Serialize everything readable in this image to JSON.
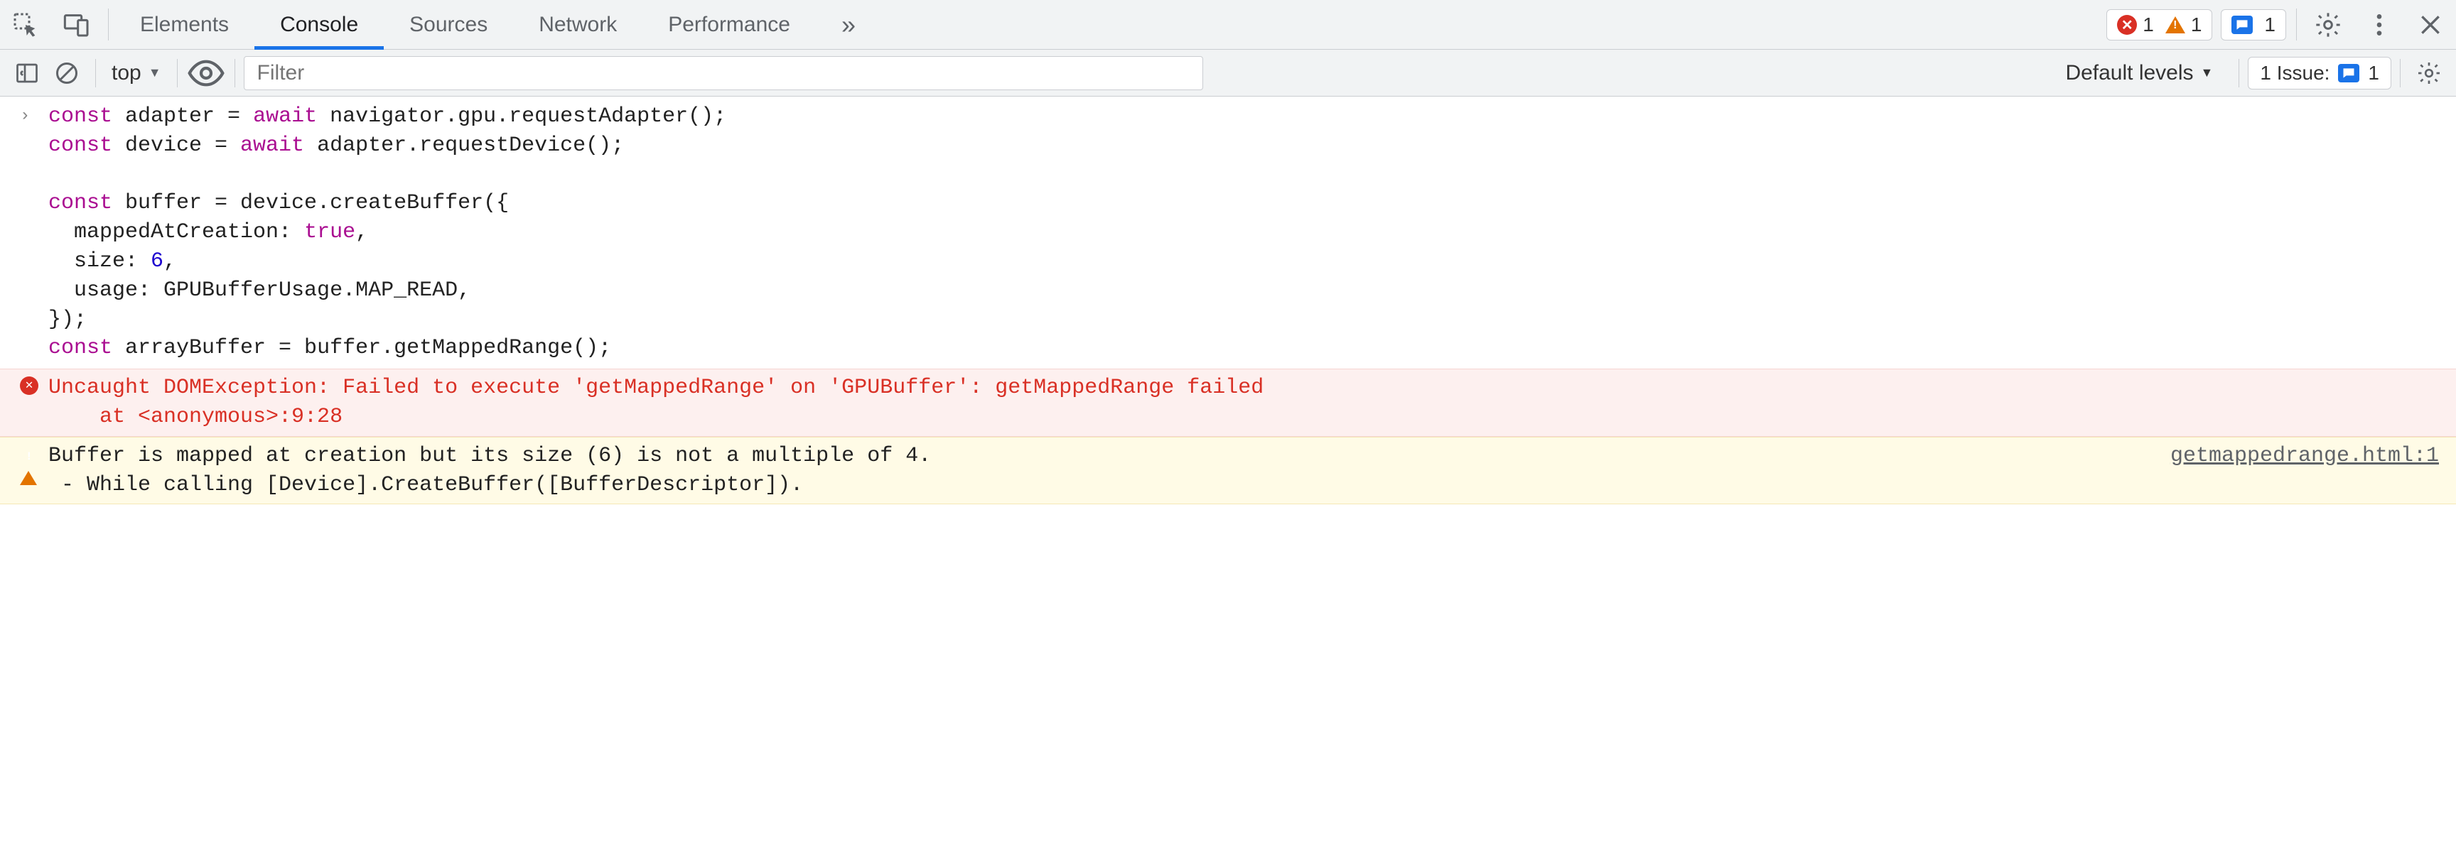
{
  "tabs": {
    "elements": "Elements",
    "console": "Console",
    "sources": "Sources",
    "network": "Network",
    "performance": "Performance"
  },
  "badges": {
    "errors": "1",
    "warnings": "1",
    "info": "1"
  },
  "toolbar": {
    "context": "top",
    "filter_placeholder": "Filter",
    "levels": "Default levels",
    "issues_label": "1 Issue:",
    "issues_count": "1"
  },
  "console_input": {
    "prompt": "›",
    "tokens": {
      "const": "const",
      "await": "await",
      "true": "true",
      "six": "6",
      "line1a": " adapter = ",
      "line1b": " navigator.gpu.requestAdapter();",
      "line2a": " device = ",
      "line2b": " adapter.requestDevice();",
      "line4a": " buffer = device.createBuffer({",
      "line5a": "  mappedAtCreation: ",
      "line5b": ",",
      "line6a": "  size: ",
      "line6b": ",",
      "line7": "  usage: GPUBufferUsage.MAP_READ,",
      "line8": "});",
      "line9": " arrayBuffer = buffer.getMappedRange();"
    }
  },
  "error": {
    "line1": "Uncaught DOMException: Failed to execute 'getMappedRange' on 'GPUBuffer': getMappedRange failed",
    "line2": "    at <anonymous>:9:28"
  },
  "warning": {
    "line1": "Buffer is mapped at creation but its size (6) is not a multiple of 4.",
    "line2": " - While calling [Device].CreateBuffer([BufferDescriptor]).",
    "source": "getmappedrange.html:1"
  }
}
